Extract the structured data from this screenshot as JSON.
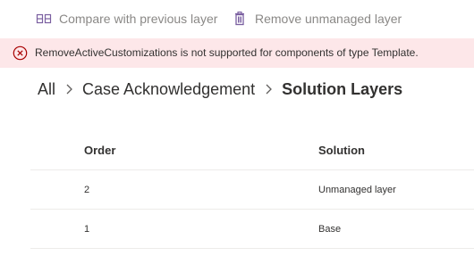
{
  "toolbar": {
    "compare_label": "Compare with previous layer",
    "remove_label": "Remove unmanaged layer",
    "compare_icon": "compare-icon",
    "remove_icon": "trash-icon"
  },
  "banner": {
    "icon": "error-circle-icon",
    "message": "RemoveActiveCustomizations is not supported for components of type Template.",
    "background": "#fde7e9",
    "icon_color": "#a80000"
  },
  "breadcrumb": {
    "items": [
      "All",
      "Case Acknowledgement"
    ],
    "current": "Solution Layers"
  },
  "table": {
    "columns": [
      "Order",
      "Solution"
    ],
    "rows": [
      [
        "2",
        "Unmanaged layer"
      ],
      [
        "1",
        "Base"
      ]
    ]
  }
}
